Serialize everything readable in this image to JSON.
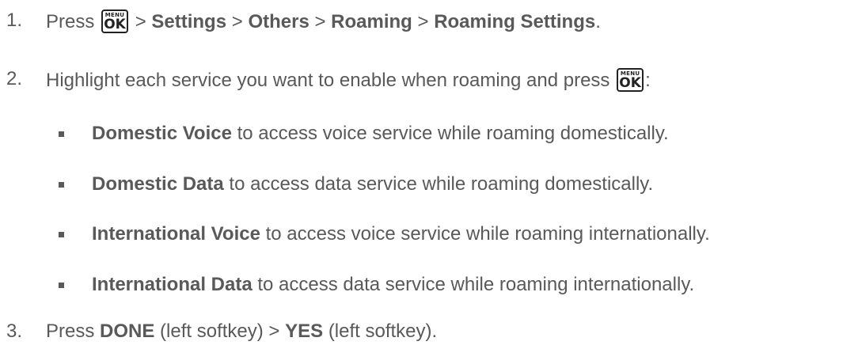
{
  "steps": [
    {
      "number": "1.",
      "parts": {
        "a": "Press",
        "b": ">",
        "c": "Settings",
        "d": ">",
        "e": "Others",
        "f": ">",
        "g": "Roaming",
        "h": ">",
        "i": "Roaming Settings",
        "j": "."
      }
    },
    {
      "number": "2.",
      "parts": {
        "a": "Highlight each service you want to enable when roaming and press",
        "b": ":"
      }
    },
    {
      "number": "3.",
      "parts": {
        "a": "Press",
        "b": "DONE",
        "c": "(left softkey) >",
        "d": "YES",
        "e": "(left softkey)."
      }
    }
  ],
  "bullets": [
    {
      "bold": "Domestic Voice",
      "text": "to access voice service while roaming domestically."
    },
    {
      "bold": "Domestic Data",
      "text": "to access data service while roaming domestically."
    },
    {
      "bold": "International Voice",
      "text": "to access voice service while roaming internationally."
    },
    {
      "bold": "International Data",
      "text": "to access data service while roaming internationally."
    }
  ],
  "key": {
    "top": "MENU",
    "main": "OK"
  },
  "colors": {
    "text": "#595959",
    "key_border": "#222222"
  },
  "icons": [
    "menu-ok-key-icon",
    "bullet-square-icon"
  ]
}
